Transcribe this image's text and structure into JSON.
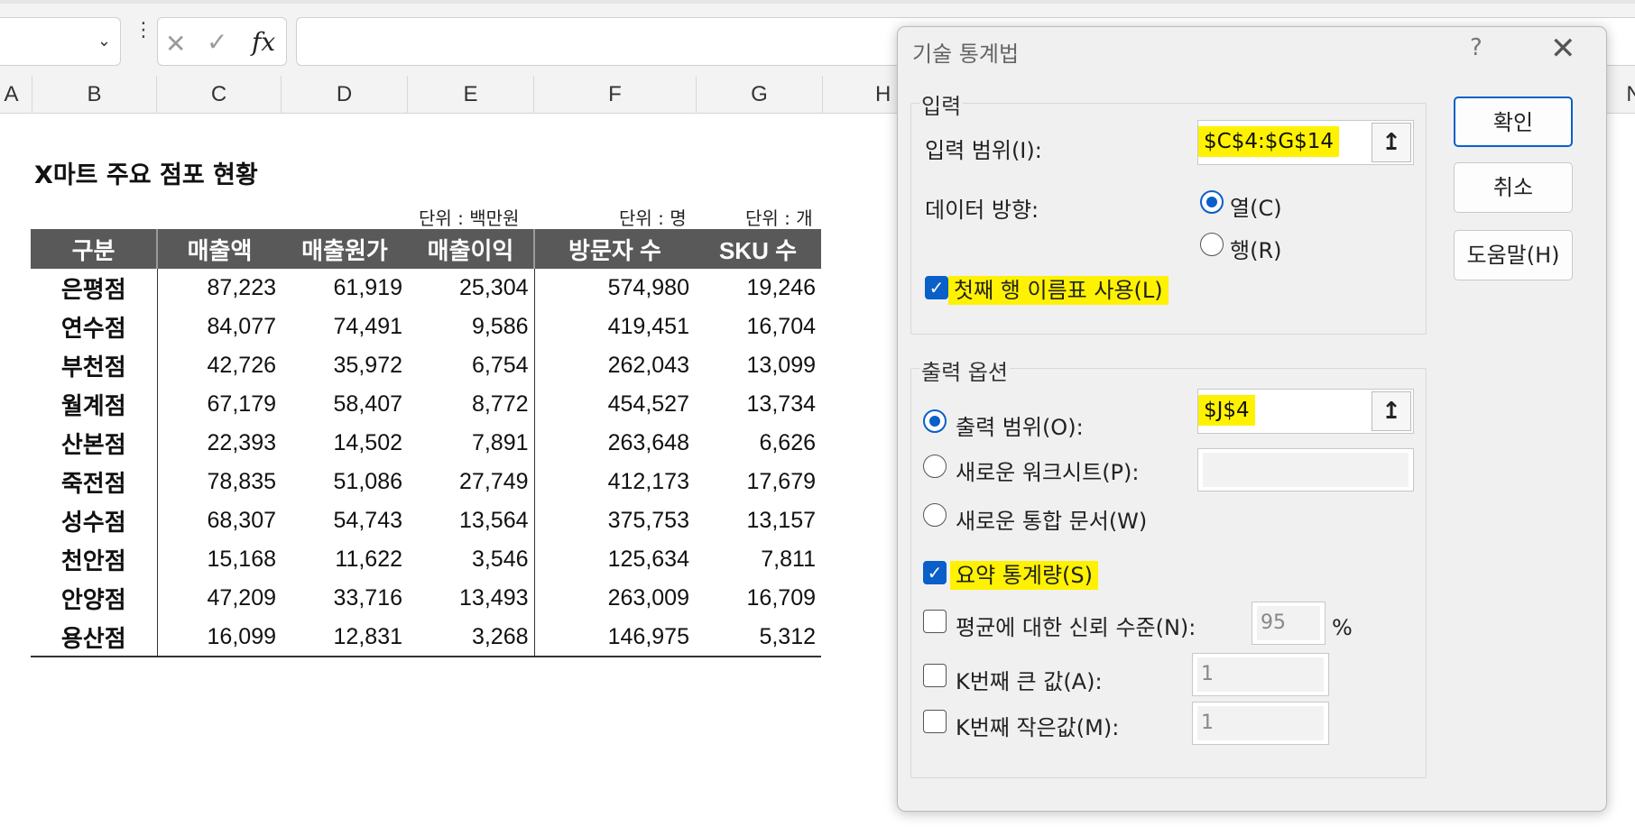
{
  "formula_bar": {
    "name_box_value": "",
    "cancel_icon": "close-icon",
    "enter_icon": "checkmark-icon",
    "fx_label": "fx",
    "formula_value": ""
  },
  "columns": [
    "A",
    "B",
    "C",
    "D",
    "E",
    "F",
    "G",
    "H",
    "N"
  ],
  "sheet": {
    "title": "X마트 주요 점포 현황",
    "units": [
      "단위 : 백만원",
      "단위 : 명",
      "단위 : 개"
    ],
    "headers": [
      "구분",
      "매출액",
      "매출원가",
      "매출이익",
      "방문자 수",
      "SKU 수"
    ],
    "rows": [
      [
        "은평점",
        "87,223",
        "61,919",
        "25,304",
        "574,980",
        "19,246"
      ],
      [
        "연수점",
        "84,077",
        "74,491",
        "9,586",
        "419,451",
        "16,704"
      ],
      [
        "부천점",
        "42,726",
        "35,972",
        "6,754",
        "262,043",
        "13,099"
      ],
      [
        "월계점",
        "67,179",
        "58,407",
        "8,772",
        "454,527",
        "13,734"
      ],
      [
        "산본점",
        "22,393",
        "14,502",
        "7,891",
        "263,648",
        "6,626"
      ],
      [
        "죽전점",
        "78,835",
        "51,086",
        "27,749",
        "412,173",
        "17,679"
      ],
      [
        "성수점",
        "68,307",
        "54,743",
        "13,564",
        "375,753",
        "13,157"
      ],
      [
        "천안점",
        "15,168",
        "11,622",
        "3,546",
        "125,634",
        "7,811"
      ],
      [
        "안양점",
        "47,209",
        "33,716",
        "13,493",
        "263,009",
        "16,709"
      ],
      [
        "용산점",
        "16,099",
        "12,831",
        "3,268",
        "146,975",
        "5,312"
      ]
    ]
  },
  "dialog": {
    "title": "기술 통계법",
    "help": "?",
    "close": "✕",
    "input_group": {
      "legend": "입력",
      "range_label": "입력 범위(I):",
      "range_value": "$C$4:$G$14",
      "direction_label": "데이터 방향:",
      "option_column": "열(C)",
      "option_row": "행(R)",
      "first_row_labels": "첫째 행 이름표 사용(L)"
    },
    "output_group": {
      "legend": "출력 옵션",
      "output_range_label": "출력 범위(O):",
      "output_range_value": "$J$4",
      "new_worksheet_label": "새로운 워크시트(P):",
      "new_workbook_label": "새로운 통합 문서(W)",
      "summary_stats_label": "요약 통계량(S)",
      "confidence_label": "평균에 대한 신뢰 수준(N):",
      "confidence_value": "95",
      "confidence_unit": "%",
      "kth_largest_label": "K번째 큰 값(A):",
      "kth_largest_value": "1",
      "kth_smallest_label": "K번째 작은값(M):",
      "kth_smallest_value": "1"
    },
    "buttons": {
      "ok": "확인",
      "cancel": "취소",
      "help": "도움말(H)"
    },
    "collapse_icon": "↥",
    "highlight_color": "#fff200",
    "accent_color": "#0a5fc8"
  }
}
